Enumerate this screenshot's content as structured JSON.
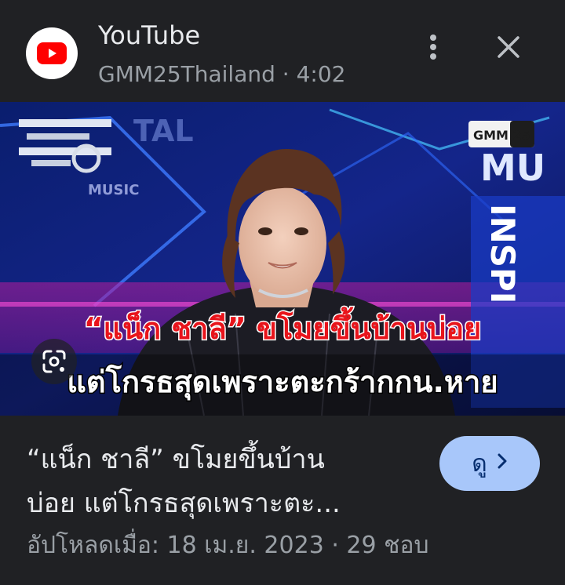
{
  "header": {
    "source_name": "YouTube",
    "channel": "GMM25Thailand",
    "separator": "·",
    "duration": "4:02"
  },
  "thumbnail": {
    "overlay_line1": "“แน็ก ชาลี” ขโมยขึ้นบ้านบ่อย",
    "overlay_line2": "แต่โกรธสุดเพราะตะกร้ากกน.หาย",
    "channel_badge": "GMM 25",
    "backdrop_text_music": "MUSIC",
    "backdrop_text_side": "MU",
    "backdrop_text_vertical": "INSPI",
    "backdrop_text_tal": "TAL"
  },
  "video": {
    "title_line1": "“แน็ก ชาลี” ขโมยขึ้นบ้าน",
    "title_line2": "บ่อย แต่โกรธสุดเพราะตะ...",
    "watch_label": "ดู",
    "upload_info": "อัปโหลดเมื่อ: 18 เม.ย. 2023 · 29 ชอบ"
  },
  "colors": {
    "background": "#202124",
    "primary_text": "#e8eaed",
    "secondary_text": "#9aa0a6",
    "watch_button_bg": "#a8c7fa",
    "watch_button_text": "#062e6f",
    "youtube_red": "#ff0000",
    "overlay_red": "#e8141b"
  },
  "icons": {
    "logo": "youtube-logo-icon",
    "menu": "more-vert-icon",
    "close": "close-icon",
    "lens": "google-lens-icon",
    "watch_chevron": "chevron-right-icon"
  }
}
